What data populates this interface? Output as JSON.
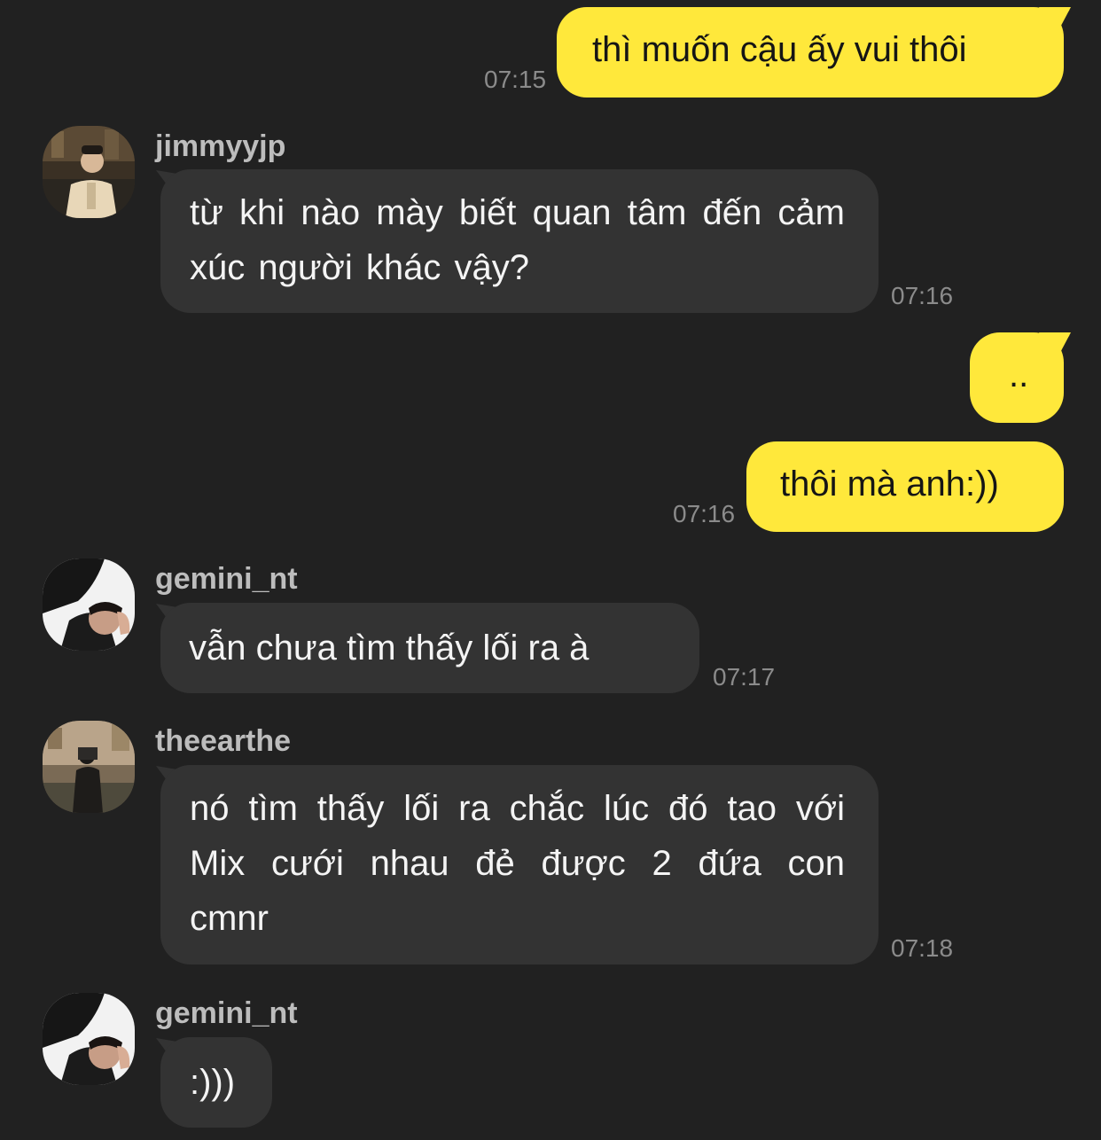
{
  "messages": [
    {
      "direction": "outgoing",
      "text": "thì muốn cậu ấy vui thôi",
      "time": "07:15"
    },
    {
      "direction": "incoming",
      "username": "jimmyyjp",
      "avatar": "user-photo-jimmyyjp",
      "text": "từ khi nào mày biết quan tâm đến cảm xúc người khác vậy?",
      "time": "07:16"
    },
    {
      "direction": "outgoing",
      "text": "..",
      "time": ""
    },
    {
      "direction": "outgoing",
      "text": "thôi mà anh:))",
      "time": "07:16"
    },
    {
      "direction": "incoming",
      "username": "gemini_nt",
      "avatar": "user-photo-gemini",
      "text": "vẫn chưa tìm thấy lối ra à",
      "time": "07:17"
    },
    {
      "direction": "incoming",
      "username": "theearthe",
      "avatar": "user-photo-theearthe",
      "text": "nó tìm thấy lối ra chắc lúc đó tao với Mix cưới nhau đẻ được 2 đứa con cmnr",
      "time": "07:18"
    },
    {
      "direction": "incoming",
      "username": "gemini_nt",
      "avatar": "user-photo-gemini",
      "text": ":)))",
      "time": ""
    }
  ],
  "colors": {
    "background": "#212121",
    "outgoing_bubble": "#ffe83b",
    "incoming_bubble": "#333333",
    "timestamp": "#8b8b8b",
    "username": "#bdbdbd"
  }
}
